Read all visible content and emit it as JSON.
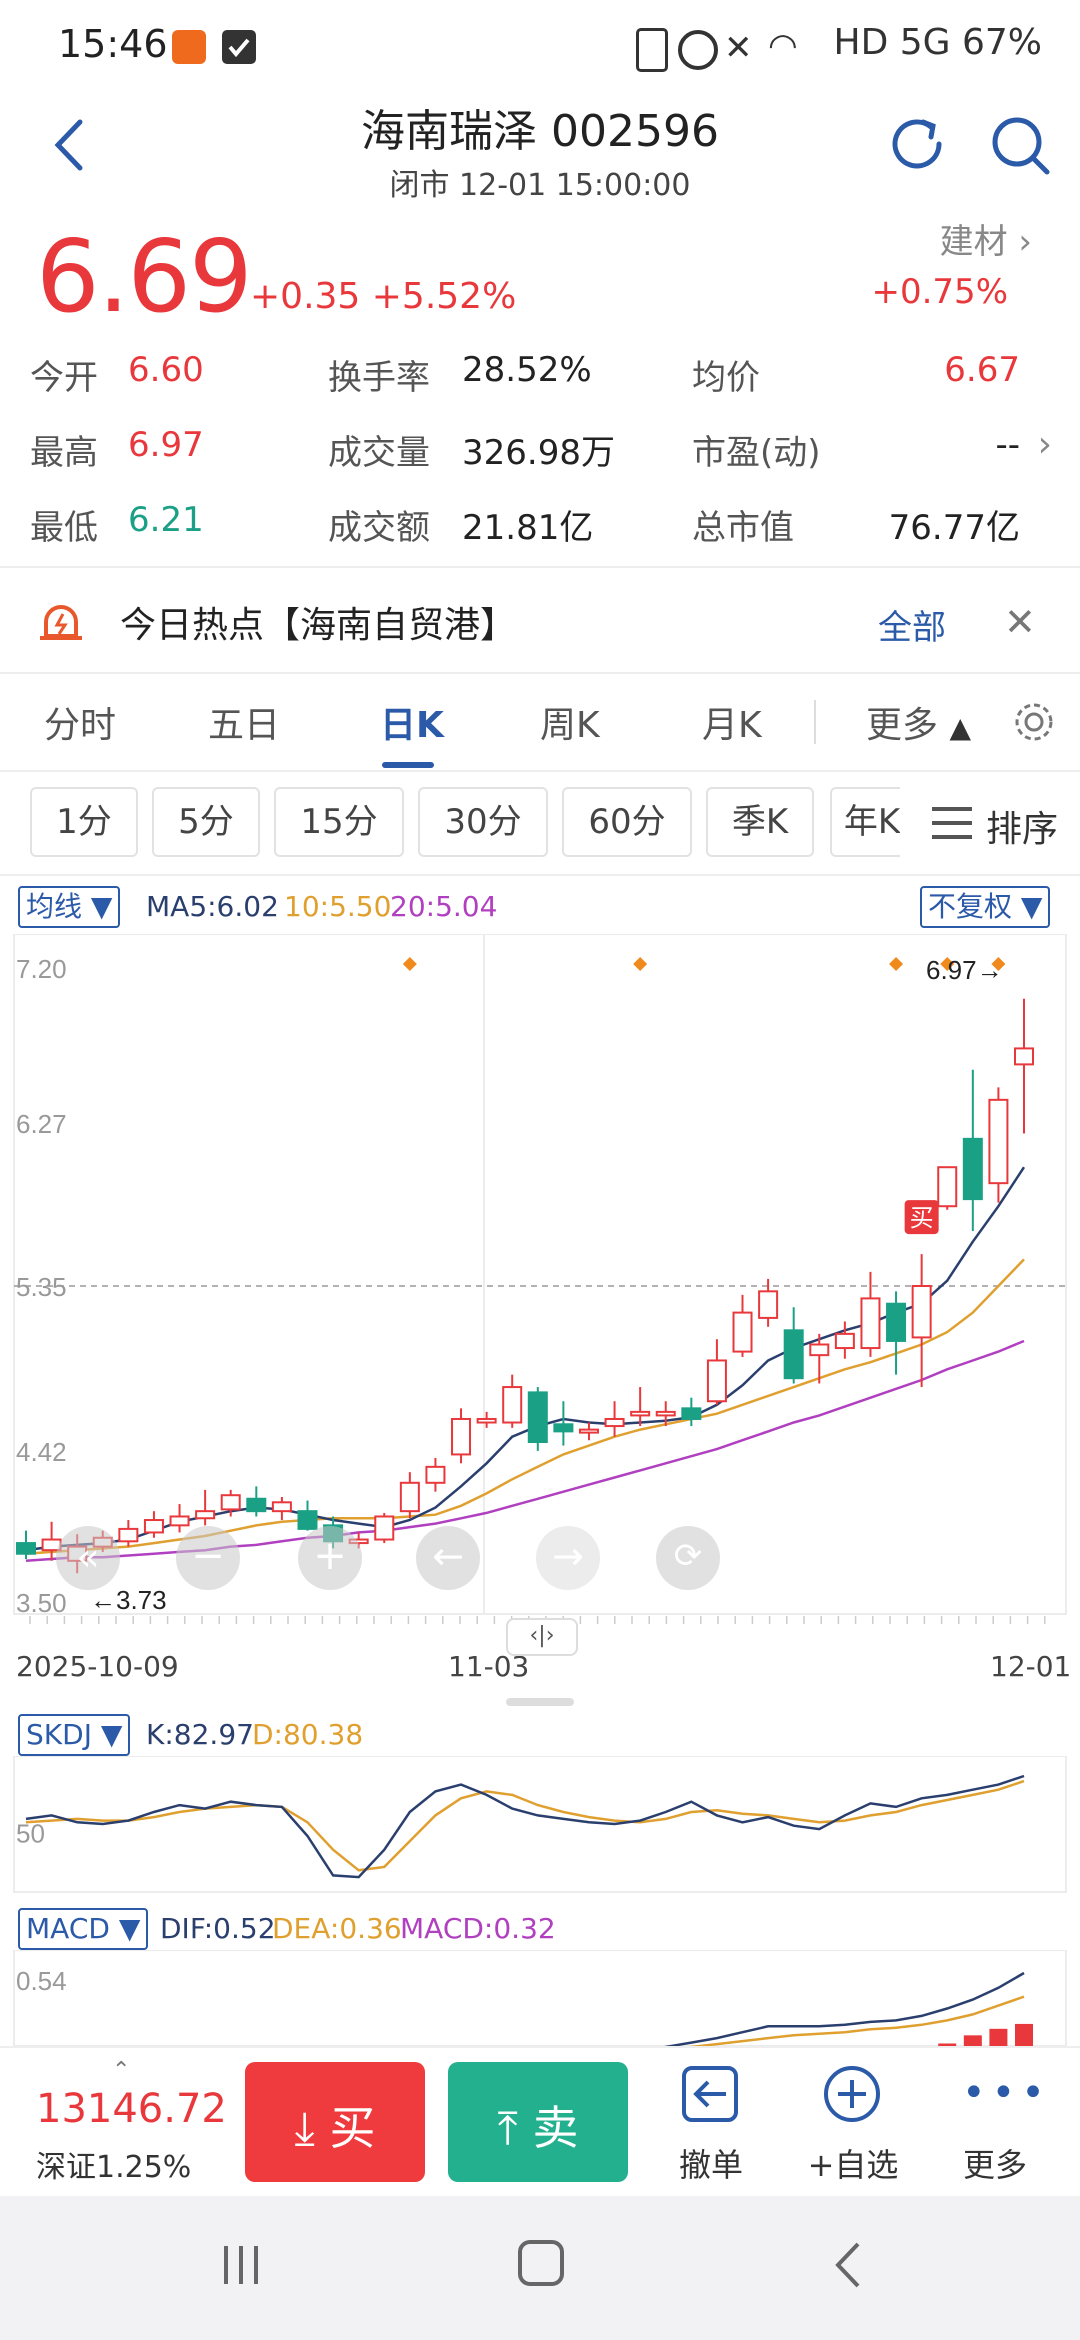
{
  "status_bar": {
    "time": "15:46",
    "right_text": "HD 5G 67%",
    "battery": "67%",
    "icons": [
      "app-notification-icon",
      "checkbox-icon",
      "alarm-icon",
      "mute-icon",
      "wifi-icon",
      "signal-icon",
      "battery-icon"
    ]
  },
  "header": {
    "title": "海南瑞泽 002596",
    "subtitle": "闭市 12-01 15:00:00"
  },
  "quote": {
    "price": "6.69",
    "change": "+0.35 +5.52%",
    "sector_name": "建材",
    "sector_change": "+0.75%",
    "stats": [
      {
        "label": "今开",
        "value": "6.60"
      },
      {
        "label": "换手率",
        "value": "28.52%"
      },
      {
        "label": "均价",
        "value": "6.67"
      },
      {
        "label": "最高",
        "value": "6.97"
      },
      {
        "label": "成交量",
        "value": "326.98万"
      },
      {
        "label": "市盈(动)",
        "value": "--"
      },
      {
        "label": "最低",
        "value": "6.21"
      },
      {
        "label": "成交额",
        "value": "21.81亿"
      },
      {
        "label": "总市值",
        "value": "76.77亿"
      }
    ]
  },
  "hot": {
    "text": "今日热点【海南自贸港】",
    "all_label": "全部"
  },
  "tabs": [
    "分时",
    "五日",
    "日K",
    "周K",
    "月K",
    "更多"
  ],
  "intervals": [
    "1分",
    "5分",
    "15分",
    "30分",
    "60分",
    "季K",
    "年K"
  ],
  "sort_label": "排序",
  "kline": {
    "ma_chip": "均线",
    "ma5": "MA5:6.02",
    "ma10": "10:5.50",
    "ma20": "20:5.04",
    "adjust_chip": "不复权",
    "y_labels": [
      "7.20",
      "6.27",
      "5.35",
      "4.42",
      "3.50"
    ],
    "x_labels": [
      "2025-10-09",
      "11-03",
      "12-01"
    ],
    "high_marker": "6.97→",
    "low_marker": "←3.73",
    "buy_tag": "买"
  },
  "skdj": {
    "chip": "SKDJ",
    "k": "K:82.97",
    "d": "D:80.38",
    "y_label": "50"
  },
  "macd": {
    "chip": "MACD",
    "dif": "DIF:0.52",
    "dea": "DEA:0.36",
    "macd": "MACD:0.32",
    "y_label": "0.54"
  },
  "bottom": {
    "index_value": "13146.72",
    "index_label": "深证1.25%",
    "buy": "买",
    "sell": "卖",
    "cancel": "撤单",
    "watch": "+自选",
    "more": "更多"
  },
  "colors": {
    "up": "#e8383c",
    "down": "#1aa085",
    "accent": "#2b5aa8",
    "ma5": "#2a3f6e",
    "ma10": "#e0a030",
    "ma20": "#b040c0"
  },
  "chart_data": {
    "type": "candlestick",
    "y_range": [
      3.5,
      7.2
    ],
    "candles": [
      {
        "o": 3.9,
        "h": 3.97,
        "l": 3.81,
        "c": 3.84,
        "up": false
      },
      {
        "o": 3.86,
        "h": 4.02,
        "l": 3.8,
        "c": 3.92,
        "up": true
      },
      {
        "o": 3.8,
        "h": 3.95,
        "l": 3.73,
        "c": 3.88,
        "up": true
      },
      {
        "o": 3.88,
        "h": 3.97,
        "l": 3.85,
        "c": 3.93,
        "up": true
      },
      {
        "o": 3.91,
        "h": 4.03,
        "l": 3.88,
        "c": 3.98,
        "up": true
      },
      {
        "o": 3.96,
        "h": 4.08,
        "l": 3.93,
        "c": 4.03,
        "up": true
      },
      {
        "o": 4.0,
        "h": 4.12,
        "l": 3.96,
        "c": 4.05,
        "up": true
      },
      {
        "o": 4.04,
        "h": 4.2,
        "l": 4.0,
        "c": 4.08,
        "up": true
      },
      {
        "o": 4.09,
        "h": 4.2,
        "l": 4.05,
        "c": 4.17,
        "up": true
      },
      {
        "o": 4.15,
        "h": 4.22,
        "l": 4.05,
        "c": 4.08,
        "up": false
      },
      {
        "o": 4.08,
        "h": 4.16,
        "l": 4.03,
        "c": 4.13,
        "up": true
      },
      {
        "o": 4.08,
        "h": 4.14,
        "l": 3.97,
        "c": 3.98,
        "up": false
      },
      {
        "o": 4.0,
        "h": 4.05,
        "l": 3.87,
        "c": 3.91,
        "up": false
      },
      {
        "o": 3.9,
        "h": 3.96,
        "l": 3.87,
        "c": 3.92,
        "up": true
      },
      {
        "o": 3.92,
        "h": 4.07,
        "l": 3.9,
        "c": 4.05,
        "up": true
      },
      {
        "o": 4.08,
        "h": 4.3,
        "l": 4.04,
        "c": 4.24,
        "up": true
      },
      {
        "o": 4.24,
        "h": 4.38,
        "l": 4.19,
        "c": 4.33,
        "up": true
      },
      {
        "o": 4.4,
        "h": 4.66,
        "l": 4.35,
        "c": 4.6,
        "up": true
      },
      {
        "o": 4.58,
        "h": 4.64,
        "l": 4.55,
        "c": 4.6,
        "up": true
      },
      {
        "o": 4.58,
        "h": 4.85,
        "l": 4.55,
        "c": 4.78,
        "up": true
      },
      {
        "o": 4.75,
        "h": 4.78,
        "l": 4.42,
        "c": 4.47,
        "up": false
      },
      {
        "o": 4.53,
        "h": 4.7,
        "l": 4.45,
        "c": 4.57,
        "up": false
      },
      {
        "o": 4.54,
        "h": 4.58,
        "l": 4.48,
        "c": 4.54,
        "up": true
      },
      {
        "o": 4.56,
        "h": 4.7,
        "l": 4.5,
        "c": 4.6,
        "up": true
      },
      {
        "o": 4.62,
        "h": 4.78,
        "l": 4.56,
        "c": 4.64,
        "up": true
      },
      {
        "o": 4.64,
        "h": 4.7,
        "l": 4.56,
        "c": 4.62,
        "up": true
      },
      {
        "o": 4.66,
        "h": 4.72,
        "l": 4.56,
        "c": 4.6,
        "up": false
      },
      {
        "o": 4.7,
        "h": 5.05,
        "l": 4.68,
        "c": 4.93,
        "up": true
      },
      {
        "o": 4.98,
        "h": 5.3,
        "l": 4.95,
        "c": 5.2,
        "up": true
      },
      {
        "o": 5.17,
        "h": 5.39,
        "l": 5.12,
        "c": 5.32,
        "up": true
      },
      {
        "o": 5.1,
        "h": 5.23,
        "l": 4.8,
        "c": 4.83,
        "up": false
      },
      {
        "o": 4.96,
        "h": 5.08,
        "l": 4.8,
        "c": 5.02,
        "up": true
      },
      {
        "o": 5.0,
        "h": 5.15,
        "l": 4.94,
        "c": 5.08,
        "up": true
      },
      {
        "o": 5.0,
        "h": 5.43,
        "l": 4.95,
        "c": 5.28,
        "up": true
      },
      {
        "o": 5.25,
        "h": 5.32,
        "l": 4.85,
        "c": 5.04,
        "up": false
      },
      {
        "o": 5.06,
        "h": 5.53,
        "l": 4.78,
        "c": 5.35,
        "up": true
      },
      {
        "o": 5.8,
        "h": 6.02,
        "l": 5.78,
        "c": 6.02,
        "up": true
      },
      {
        "o": 6.18,
        "h": 6.57,
        "l": 5.66,
        "c": 5.84,
        "up": false
      },
      {
        "o": 5.93,
        "h": 6.47,
        "l": 5.82,
        "c": 6.4,
        "up": true
      },
      {
        "o": 6.6,
        "h": 6.97,
        "l": 6.21,
        "c": 6.69,
        "up": true
      }
    ],
    "ma5": [
      3.86,
      3.88,
      3.89,
      3.9,
      3.92,
      3.97,
      4.02,
      4.05,
      4.08,
      4.1,
      4.09,
      4.06,
      4.03,
      4.01,
      3.99,
      4.03,
      4.1,
      4.22,
      4.35,
      4.5,
      4.56,
      4.6,
      4.58,
      4.57,
      4.58,
      4.59,
      4.61,
      4.68,
      4.79,
      4.93,
      5.0,
      5.05,
      5.1,
      5.14,
      5.2,
      5.25,
      5.38,
      5.6,
      5.8,
      6.02
    ],
    "ma10": [
      3.84,
      3.85,
      3.86,
      3.87,
      3.88,
      3.9,
      3.92,
      3.94,
      3.97,
      4.0,
      4.02,
      4.03,
      4.04,
      4.04,
      4.04,
      4.05,
      4.06,
      4.11,
      4.18,
      4.26,
      4.33,
      4.4,
      4.45,
      4.5,
      4.54,
      4.57,
      4.6,
      4.63,
      4.68,
      4.73,
      4.78,
      4.83,
      4.88,
      4.92,
      4.97,
      5.02,
      5.09,
      5.2,
      5.35,
      5.5
    ],
    "ma20": [
      3.8,
      3.81,
      3.82,
      3.82,
      3.83,
      3.84,
      3.85,
      3.86,
      3.88,
      3.89,
      3.91,
      3.93,
      3.94,
      3.96,
      3.97,
      3.99,
      4.01,
      4.04,
      4.07,
      4.11,
      4.15,
      4.19,
      4.23,
      4.27,
      4.31,
      4.35,
      4.39,
      4.43,
      4.48,
      4.53,
      4.58,
      4.62,
      4.67,
      4.72,
      4.77,
      4.82,
      4.88,
      4.93,
      4.98,
      5.04
    ],
    "event_markers": [
      15,
      24,
      34,
      36,
      38
    ],
    "skdj_k": [
      58,
      60,
      56,
      55,
      57,
      62,
      66,
      64,
      68,
      66,
      65,
      48,
      25,
      24,
      40,
      62,
      74,
      78,
      72,
      64,
      60,
      58,
      56,
      55,
      57,
      62,
      68,
      60,
      56,
      59,
      54,
      52,
      60,
      67,
      65,
      70,
      72,
      75,
      78,
      83
    ],
    "skdj_d": [
      56,
      57,
      58,
      57,
      57,
      59,
      62,
      64,
      65,
      66,
      65,
      56,
      40,
      28,
      30,
      45,
      60,
      70,
      74,
      72,
      66,
      62,
      59,
      57,
      56,
      58,
      62,
      63,
      61,
      60,
      58,
      56,
      57,
      60,
      62,
      66,
      69,
      72,
      75,
      80
    ],
    "macd_dif": [
      0.0,
      0.0,
      0.0,
      0.0,
      0.0,
      0.0,
      0.0,
      0.0,
      0.0,
      0.0,
      0.0,
      0.0,
      0.0,
      0.0,
      0.0,
      0.0,
      0.0,
      0.0,
      0.0,
      0.0,
      0.0,
      0.0,
      0.0,
      0.0,
      0.0,
      0.02,
      0.05,
      0.08,
      0.12,
      0.16,
      0.16,
      0.16,
      0.17,
      0.19,
      0.2,
      0.23,
      0.28,
      0.34,
      0.42,
      0.52
    ],
    "macd_dea": [
      0.0,
      0.0,
      0.0,
      0.0,
      0.0,
      0.0,
      0.0,
      0.0,
      0.0,
      0.0,
      0.0,
      0.0,
      0.0,
      0.0,
      0.0,
      0.0,
      0.0,
      0.0,
      0.0,
      0.0,
      0.0,
      0.0,
      0.0,
      0.0,
      0.0,
      0.0,
      0.02,
      0.04,
      0.06,
      0.08,
      0.1,
      0.11,
      0.12,
      0.14,
      0.15,
      0.17,
      0.2,
      0.24,
      0.3,
      0.36
    ],
    "macd_bar": [
      0,
      0,
      0,
      0,
      0,
      0,
      0,
      0,
      0,
      0,
      0,
      0,
      0,
      0,
      0,
      0,
      0,
      0,
      0,
      0,
      0,
      0,
      0,
      0,
      0,
      0,
      0,
      0,
      0,
      0,
      0,
      0,
      0,
      0,
      0,
      0,
      0.08,
      0.18,
      0.26,
      0.32
    ]
  }
}
